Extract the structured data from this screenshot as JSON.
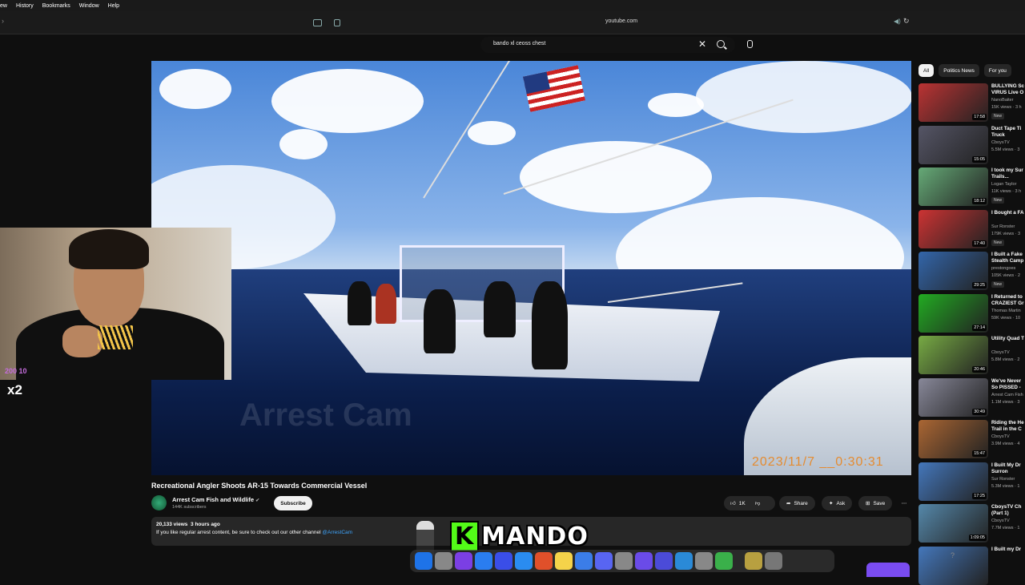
{
  "menu": [
    "ew",
    "History",
    "Bookmarks",
    "Window",
    "Help"
  ],
  "browser": {
    "url": "youtube.com"
  },
  "search": {
    "query": "bando xl ceoss chest"
  },
  "video": {
    "watermark": "Arrest Cam",
    "timestamp": "2023/11/7 __0:30:31",
    "title": "Recreational Angler Shoots AR-15 Towards Commercial Vessel",
    "channel": "Arrest Cam Fish and Wildlife",
    "subscribers": "144K subscribers",
    "subscribe_label": "Subscribe",
    "likes": "1K",
    "share_label": "Share",
    "ask_label": "Ask",
    "save_label": "Save",
    "views": "20,133 views",
    "age": "3 hours ago",
    "description": "If you like regular arrest content, be sure to check out our other channel",
    "description_link": "@ArrestCam"
  },
  "overlay": {
    "multiplier": "x2",
    "badge": "200 10",
    "brand": "MANDO",
    "brand_k": "K"
  },
  "chips": [
    "All",
    "Politics News",
    "For you"
  ],
  "recommendations": [
    {
      "title": "BULLYING Sc",
      "title2": "VIRUS Live O",
      "channel": "NanoBaiter",
      "views": "15K views · 3 h",
      "duration": "17:58",
      "new": "New",
      "color": "#b33"
    },
    {
      "title": "Duct Tape Ti",
      "title2": "Truck",
      "channel": "CboysTV",
      "views": "5.5M views · 3",
      "duration": "15:05",
      "new": "",
      "color": "#556"
    },
    {
      "title": "I took my Sur",
      "title2": "Trails...",
      "channel": "Logan Taylor",
      "views": "11K views · 3 h",
      "duration": "18:12",
      "new": "New",
      "color": "#6a7"
    },
    {
      "title": "I Bought a FA",
      "title2": "",
      "channel": "Sur Ronster",
      "views": "179K views · 3",
      "duration": "17:40",
      "new": "New",
      "color": "#c33"
    },
    {
      "title": "I Built a Fake",
      "title2": "Stealth Camp",
      "channel": "prestongoes",
      "views": "105K views · 2",
      "duration": "29:25",
      "new": "New",
      "color": "#36a"
    },
    {
      "title": "I Returned to",
      "title2": "CRAZIEST Gr",
      "channel": "Thomas Martin",
      "views": "59K views · 10",
      "duration": "27:14",
      "new": "",
      "color": "#2a2"
    },
    {
      "title": "Utility Quad T",
      "title2": "",
      "channel": "CboysTV",
      "views": "5.8M views · 2",
      "duration": "20:46",
      "new": "",
      "color": "#7a4"
    },
    {
      "title": "We've Never",
      "title2": "So PISSED - ",
      "channel": "Arrest Cam Fish",
      "views": "1.1M views · 3",
      "duration": "30:49",
      "new": "",
      "color": "#889"
    },
    {
      "title": "Riding the He",
      "title2": "Trail in the C",
      "channel": "CboysTV",
      "views": "3.9M views · 4",
      "duration": "15:47",
      "new": "",
      "color": "#a63"
    },
    {
      "title": "I Built My Dr",
      "title2": "Surron",
      "channel": "Sur Ronster",
      "views": "5.3M views · 1",
      "duration": "17:25",
      "new": "",
      "color": "#47b"
    },
    {
      "title": "CboysTV Ch",
      "title2": "(Part 1)",
      "channel": "CboysTV",
      "views": "7.7M views · 1",
      "duration": "1:09:05",
      "new": "",
      "color": "#58a"
    },
    {
      "title": "I Built my Dr",
      "title2": "",
      "channel": "",
      "views": "",
      "duration": "",
      "new": "",
      "color": "#47b"
    }
  ],
  "dock_colors": [
    "#1e73e8",
    "#888",
    "#7b3fe4",
    "#2a7df0",
    "#3a4ee8",
    "#2a8cf0",
    "#e0502a",
    "#f5d34a",
    "#3b7de8",
    "#5865f2",
    "#888",
    "#6a4be8",
    "#4b4bd8",
    "#2a8ad8",
    "#888",
    "#3ab04a",
    "#b8a040",
    "#777"
  ]
}
